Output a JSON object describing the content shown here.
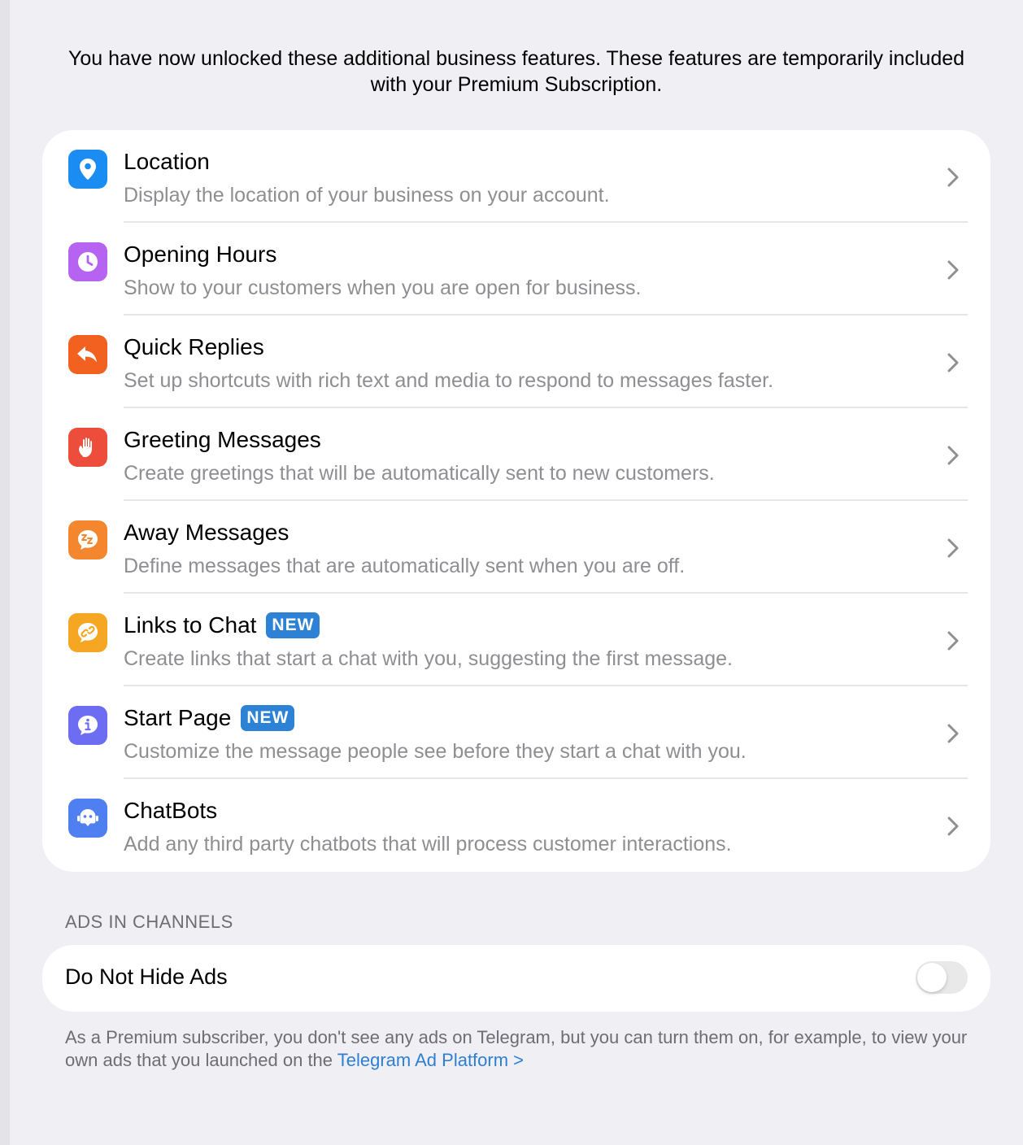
{
  "intro": "You have now unlocked these additional business features. These features are temporarily included with your Premium Subscription.",
  "features": [
    {
      "name": "location",
      "icon": "location-pin-icon",
      "color": "#1a8cf2",
      "title": "Location",
      "badge": "",
      "desc": "Display the location of your business on your account."
    },
    {
      "name": "opening-hours",
      "icon": "clock-icon",
      "color": "#b563f0",
      "title": "Opening Hours",
      "badge": "",
      "desc": "Show to your customers when you are open for business."
    },
    {
      "name": "quick-replies",
      "icon": "reply-arrow-icon",
      "color": "#f2611f",
      "title": "Quick Replies",
      "badge": "",
      "desc": "Set up shortcuts with rich text and media to respond to messages faster."
    },
    {
      "name": "greeting-messages",
      "icon": "waving-hand-icon",
      "color": "#ed4e3c",
      "title": "Greeting Messages",
      "badge": "",
      "desc": "Create greetings that will be automatically sent to new customers."
    },
    {
      "name": "away-messages",
      "icon": "sleep-bubble-icon",
      "color": "#f4872d",
      "title": "Away Messages",
      "badge": "",
      "desc": "Define messages that are automatically sent when you are off."
    },
    {
      "name": "links-to-chat",
      "icon": "chat-link-icon",
      "color": "#f5a623",
      "title": "Links to Chat",
      "badge": "NEW",
      "desc": "Create links that start a chat with you, suggesting the first message."
    },
    {
      "name": "start-page",
      "icon": "info-bubble-icon",
      "color": "#6d6df4",
      "title": "Start Page",
      "badge": "NEW",
      "desc": "Customize the message people see before they start a chat with you."
    },
    {
      "name": "chatbots",
      "icon": "robot-icon",
      "color": "#4f7ff0",
      "title": "ChatBots",
      "badge": "",
      "desc": "Add any third party chatbots that will process customer interactions."
    }
  ],
  "ads": {
    "section_label": "ADS IN CHANNELS",
    "toggle_label": "Do Not Hide Ads",
    "toggle_on": false,
    "footnote_text": "As a Premium subscriber, you don't see any ads on Telegram, but you can turn them on, for example, to view your own ads that you launched on the ",
    "footnote_link": "Telegram Ad Platform >"
  }
}
